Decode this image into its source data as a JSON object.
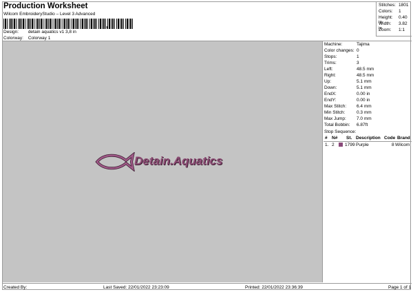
{
  "header": {
    "title": "Production Worksheet",
    "subtitle": "Wilcom EmbroideryStudio – Level 3 Advanced",
    "barcode_suffix": ",",
    "design_label": "Design:",
    "design_value": "detain aquatics v1 3,8 in",
    "colorway_label": "Colorway:",
    "colorway_value": "Colorway 1"
  },
  "stats": [
    {
      "label": "Stitches:",
      "value": "1801"
    },
    {
      "label": "Colors:",
      "value": "1"
    },
    {
      "label": "Height:",
      "value": "0.40 in"
    },
    {
      "label": "Width:",
      "value": "3.82 in"
    },
    {
      "label": "Zoom:",
      "value": "1:1"
    }
  ],
  "design": {
    "logo_text": "Detain.Aquatics",
    "background_color": "#c4c4c4",
    "thread_color": "#8c4c74"
  },
  "machine_info": [
    {
      "label": "Machine:",
      "value": "Tajima"
    },
    {
      "label": "Color changes:",
      "value": "0"
    },
    {
      "label": "Stops:",
      "value": "1"
    },
    {
      "label": "Trims:",
      "value": "3"
    },
    {
      "label": "Left:",
      "value": "48.5 mm"
    },
    {
      "label": "Right:",
      "value": "48.5 mm"
    },
    {
      "label": "Up:",
      "value": "5.1 mm"
    },
    {
      "label": "Down:",
      "value": "5.1 mm"
    },
    {
      "label": "EndX:",
      "value": "0.00 in"
    },
    {
      "label": "EndY:",
      "value": "0.00 in"
    },
    {
      "label": "Max Stitch:",
      "value": "6.4 mm"
    },
    {
      "label": "Min Stitch:",
      "value": "0.3 mm"
    },
    {
      "label": "Max Jump:",
      "value": "7.0 mm"
    },
    {
      "label": "Total Bobbin:",
      "value": "6.87ft"
    }
  ],
  "stop_sequence": {
    "title": "Stop Sequence:",
    "columns": [
      "#",
      "N#",
      "St.",
      "Description",
      "Code",
      "Brand"
    ],
    "rows": [
      {
        "index": "1.",
        "needle": "2",
        "stitches": "1799",
        "description": "Purple",
        "code": "8",
        "brand": "Wilcom",
        "swatch_color": "#8a4a7a"
      }
    ]
  },
  "footer": {
    "created_by": "Created By:",
    "last_saved": "Last Saved: 22/01/2022 23:23:09",
    "printed": "Printed: 22/01/2022 23:36:39",
    "page": "Page 1 of 1"
  }
}
